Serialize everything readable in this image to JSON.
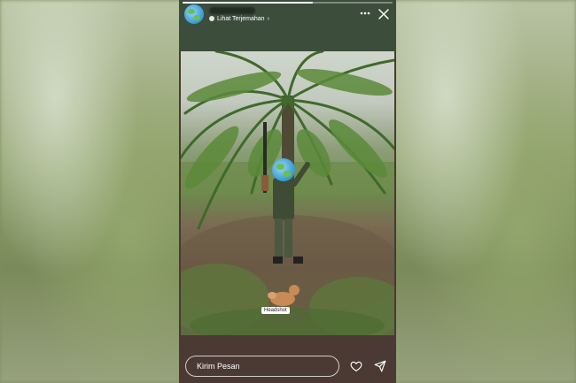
{
  "story": {
    "progress": 0.62,
    "header": {
      "translate_label": "Lihat Terjemahan",
      "translate_chevron": "›",
      "more_icon": "more-horizontal-icon",
      "close_icon": "close-icon"
    },
    "photo": {
      "sticker_label": "Headshot"
    },
    "footer": {
      "message_placeholder": "Kirim Pesan",
      "like_icon": "heart-icon",
      "send_icon": "send-icon"
    }
  },
  "colors": {
    "header_bg": "#3d4d3c",
    "footer_bg": "#4a3a33",
    "icon": "#ffffff"
  }
}
